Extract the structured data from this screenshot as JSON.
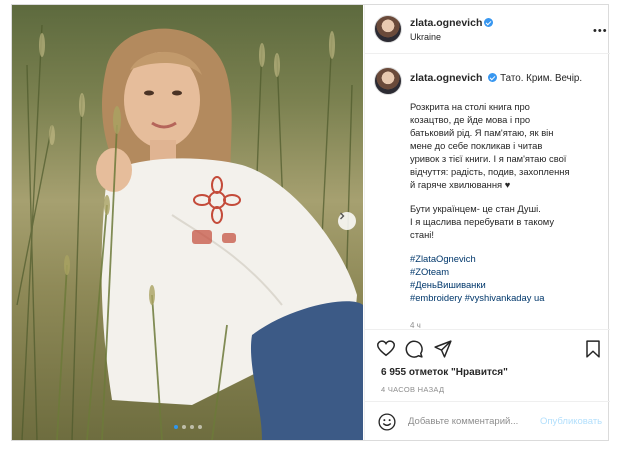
{
  "post": {
    "author": "zlata.ognevich",
    "verified": true,
    "location": "Ukraine",
    "more_icon": "ellipsis-icon",
    "carousel": {
      "slides": 4,
      "active": 0
    }
  },
  "caption": {
    "author": "zlata.ognevich",
    "first_line": "Тато. Крим. Вечір.",
    "lines": [
      "Розкрита на столі книга про",
      "козацтво, де йде мова і про",
      "батьковий рід. Я пам'ятаю, як він",
      "мене до себе покликав і читав",
      "уривок з тієї книги. І я пам'ятаю свої",
      "відчуття: радість, подив, захоплення",
      "й гаряче хвилювання ♥"
    ],
    "lines2": [
      "Бути українцем- це стан Душі.",
      "І я щаслива перебувати в такому",
      "стані!"
    ],
    "hashtags": [
      "#ZlataOgnevich",
      "#ZOteam",
      "#ДеньВишиванки",
      "#embroidery #vyshivankaday ua"
    ],
    "time": "4 ч"
  },
  "actions": {
    "like_icon": "heart-icon",
    "comment_icon": "comment-icon",
    "share_icon": "paper-plane-icon",
    "save_icon": "bookmark-icon"
  },
  "likes": {
    "count": "6 955",
    "text": "отметок \"Нравится\""
  },
  "posted_ago": "4 ЧАСОВ НАЗАД",
  "comment": {
    "placeholder": "Добавьте комментарий...",
    "publish_label": "Опубликовать",
    "emoji_icon": "smiley-icon"
  },
  "colors": {
    "link": "#00376b",
    "verified": "#3897f0",
    "publish": "#b2dffc",
    "muted": "#8e8e8e"
  }
}
